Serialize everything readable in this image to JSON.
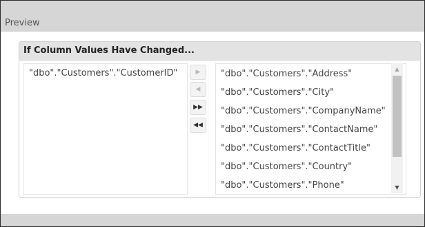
{
  "preview": {
    "title": "Preview"
  },
  "panel": {
    "title": "If Column Values Have Changed..."
  },
  "left_list": {
    "items": [
      "\"dbo\".\"Customers\".\"CustomerID\""
    ]
  },
  "right_list": {
    "items": [
      "\"dbo\".\"Customers\".\"Address\"",
      "\"dbo\".\"Customers\".\"City\"",
      "\"dbo\".\"Customers\".\"CompanyName\"",
      "\"dbo\".\"Customers\".\"ContactName\"",
      "\"dbo\".\"Customers\".\"ContactTitle\"",
      "\"dbo\".\"Customers\".\"Country\"",
      "\"dbo\".\"Customers\".\"Phone\""
    ]
  },
  "move_buttons": {
    "move_right": {
      "glyph": "▶",
      "icon": "move-right-icon",
      "enabled": false
    },
    "move_left": {
      "glyph": "◀",
      "icon": "move-left-icon",
      "enabled": false
    },
    "move_all_right": {
      "glyph": "▶▶",
      "icon": "move-all-right-icon",
      "enabled": true
    },
    "move_all_left": {
      "glyph": "◀◀",
      "icon": "move-all-left-icon",
      "enabled": true
    }
  },
  "scrollbar": {
    "up_glyph": "▲",
    "down_glyph": "▼"
  },
  "colors": {
    "header_bg": "#d6d6d6",
    "panel_header_bg": "#e3e3e3",
    "text": "#444444"
  }
}
